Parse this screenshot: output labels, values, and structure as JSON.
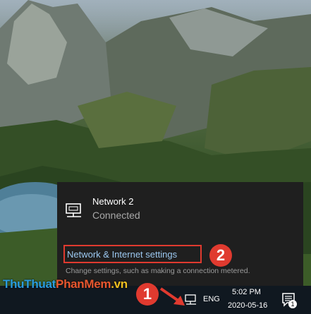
{
  "flyout": {
    "network": {
      "name": "Network 2",
      "status": "Connected"
    },
    "settings_link": "Network & Internet settings",
    "settings_description": "Change settings, such as making a connection metered."
  },
  "annotations": {
    "step1": "1",
    "step2": "2"
  },
  "watermark": {
    "part1": "ThuThuat",
    "part2": "PhanMem",
    "part3": ".vn"
  },
  "taskbar": {
    "network_icon": "network-icon",
    "language": "ENG",
    "time": "5:02 PM",
    "date": "2020-05-16",
    "notification_icon": "action-center-icon",
    "notification_count": "1"
  },
  "colors": {
    "highlight": "#e03a2f",
    "link": "#9cc8f0",
    "flyout_bg": "#1f1f1f",
    "taskbar_bg": "#101820"
  }
}
